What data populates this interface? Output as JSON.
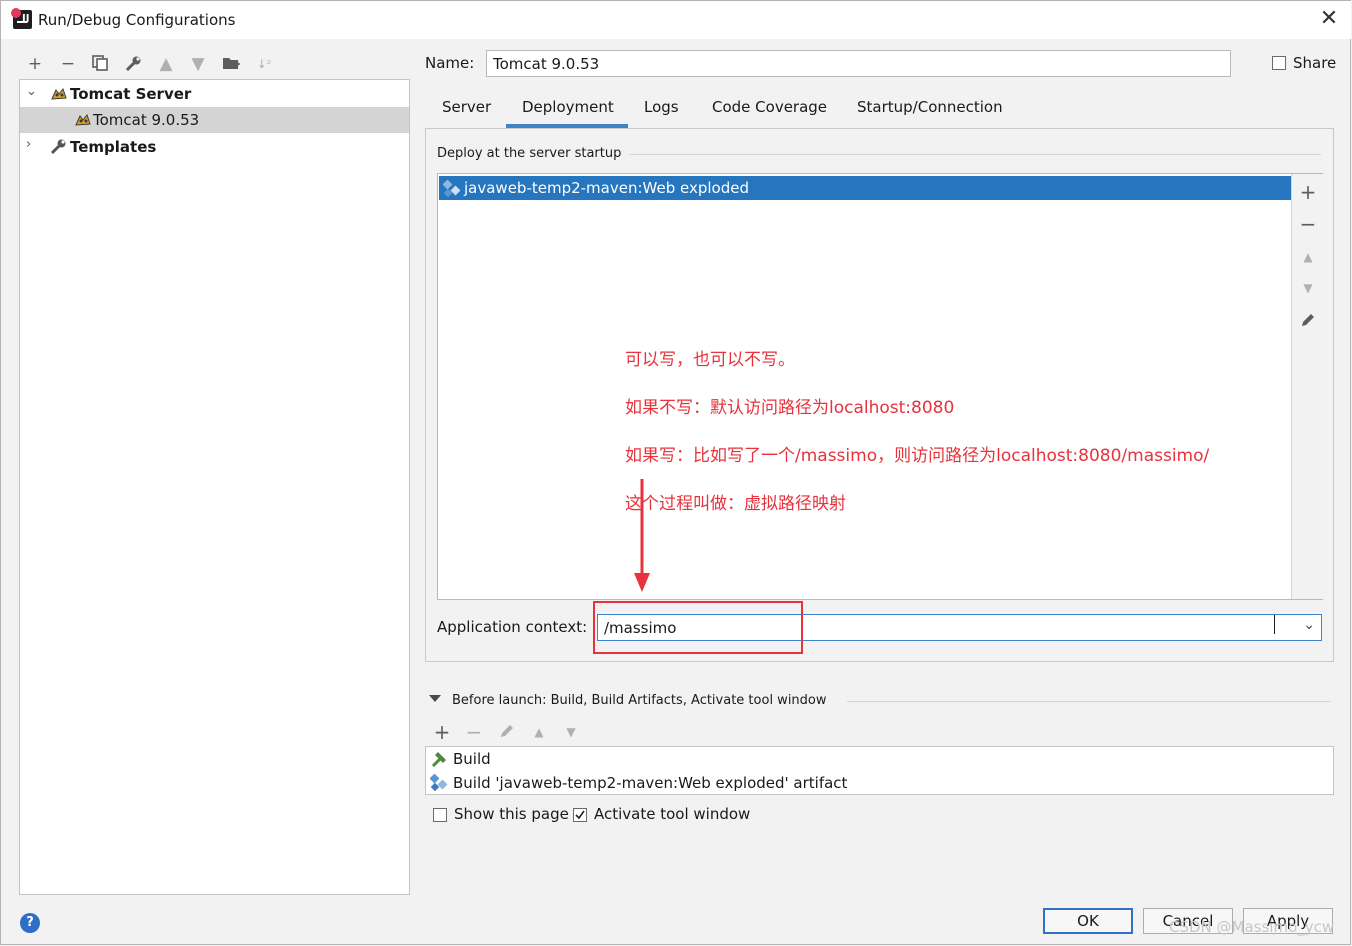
{
  "window": {
    "title": "Run/Debug Configurations"
  },
  "toolbar": {
    "icons": [
      "add-icon",
      "remove-icon",
      "copy-icon",
      "wrench-icon",
      "move-up-icon",
      "move-down-icon",
      "new-folder-icon",
      "sort-icon"
    ]
  },
  "tree": {
    "items": [
      {
        "label": "Tomcat Server",
        "icon": "tomcat-icon",
        "expanded": true,
        "bold": true
      },
      {
        "label": "Tomcat 9.0.53",
        "icon": "tomcat-icon",
        "selected": true
      },
      {
        "label": "Templates",
        "icon": "wrench-icon",
        "expanded": false,
        "bold": true
      }
    ]
  },
  "name": {
    "label": "Name:",
    "value": "Tomcat 9.0.53"
  },
  "share": {
    "label": "Share",
    "checked": false
  },
  "tabs": [
    {
      "label": "Server",
      "active": false
    },
    {
      "label": "Deployment",
      "active": true
    },
    {
      "label": "Logs",
      "active": false
    },
    {
      "label": "Code Coverage",
      "active": false
    },
    {
      "label": "Startup/Connection",
      "active": false
    }
  ],
  "deployment": {
    "section_title": "Deploy at the server startup",
    "items": [
      "javaweb-temp2-maven:Web exploded"
    ],
    "side_tools": [
      "add-icon",
      "remove-icon",
      "move-up-icon",
      "move-down-icon",
      "edit-icon"
    ],
    "app_context_label": "Application context:",
    "app_context_value": "/massimo"
  },
  "annotations": [
    "可以写，也可以不写。",
    "如果不写：默认访问路径为localhost:8080",
    "如果写：比如写了一个/massimo，则访问路径为localhost:8080/massimo/",
    "这个过程叫做：虚拟路径映射"
  ],
  "annotation_color": "#e8323c",
  "before_launch": {
    "title": "Before launch: Build, Build Artifacts, Activate tool window",
    "tools": [
      "add-icon",
      "remove-icon",
      "edit-icon",
      "move-up-icon",
      "move-down-icon"
    ],
    "items": [
      "Build",
      "Build 'javaweb-temp2-maven:Web exploded' artifact"
    ]
  },
  "options": {
    "show_page_label": "Show this page",
    "show_page_checked": false,
    "activate_label": "Activate tool window",
    "activate_checked": true
  },
  "buttons": {
    "ok": "OK",
    "cancel": "Cancel",
    "apply": "Apply"
  },
  "watermark": "CSDN @Massimo_ycw",
  "colors": {
    "selection": "#2675bf",
    "accent": "#4083c9",
    "highlight_box": "#e8323c"
  }
}
